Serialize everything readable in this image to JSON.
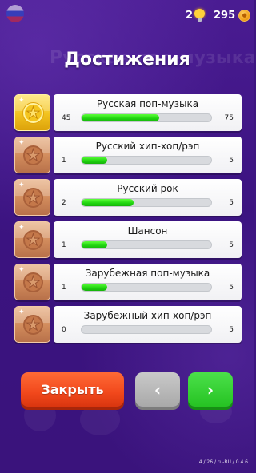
{
  "header": {
    "hints": "2",
    "coins": "295",
    "background_title": "Русская поп-музыка"
  },
  "title": "Достижения",
  "achievements": [
    {
      "name": "Русская поп-музыка",
      "current": "45",
      "target": "75",
      "progress": 0.6,
      "medal": "gold"
    },
    {
      "name": "Русский хип-хоп/рэп",
      "current": "1",
      "target": "5",
      "progress": 0.2,
      "medal": "bronze"
    },
    {
      "name": "Русский рок",
      "current": "2",
      "target": "5",
      "progress": 0.4,
      "medal": "bronze"
    },
    {
      "name": "Шансон",
      "current": "1",
      "target": "5",
      "progress": 0.2,
      "medal": "bronze"
    },
    {
      "name": "Зарубежная поп-музыка",
      "current": "1",
      "target": "5",
      "progress": 0.2,
      "medal": "bronze"
    },
    {
      "name": "Зарубежный хип-хоп/рэп",
      "current": "0",
      "target": "5",
      "progress": 0.0,
      "medal": "bronze"
    }
  ],
  "buttons": {
    "close": "Закрыть",
    "prev": "‹",
    "next": "›"
  },
  "version": "4 / 26 / ru-RU / 0.4.6",
  "colors": {
    "background": "#3d1580",
    "progress_fill": "#1fd30f",
    "close_button": "#f1481c",
    "next_button": "#26c323",
    "prev_button": "#a9a9a9"
  },
  "icons": {
    "flag": "russia-flag-icon",
    "hints": "lightbulb-icon",
    "coins": "coin-icon",
    "medal": "star-medal-icon"
  }
}
